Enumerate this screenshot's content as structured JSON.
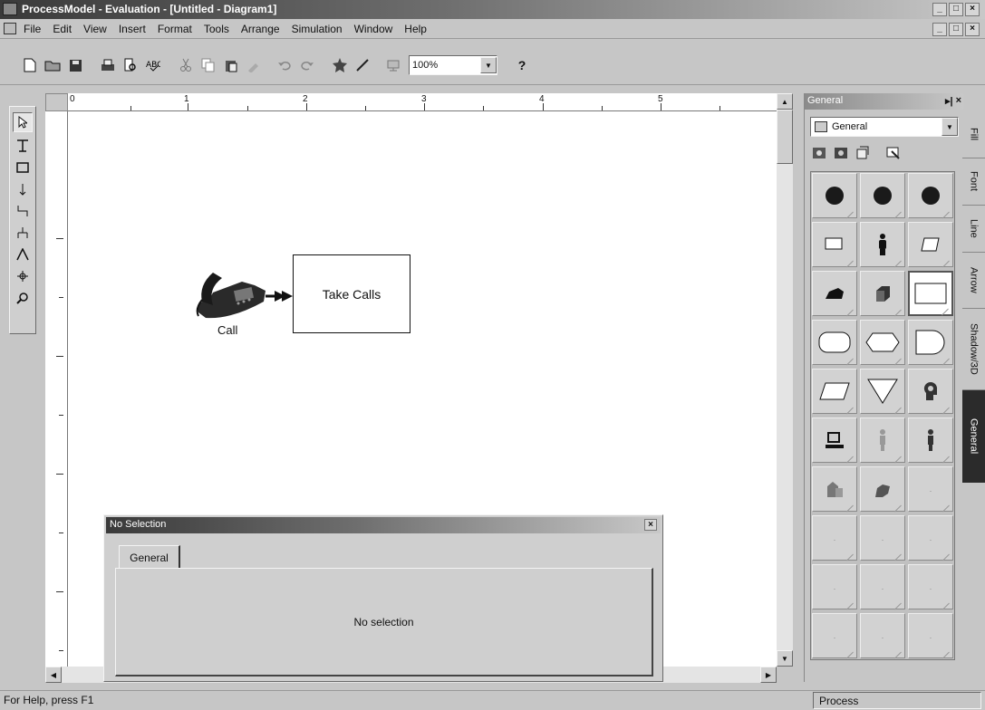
{
  "titlebar": {
    "title": "ProcessModel - Evaluation - [Untitled - Diagram1]"
  },
  "menubar": {
    "items": [
      "File",
      "Edit",
      "View",
      "Insert",
      "Format",
      "Tools",
      "Arrange",
      "Simulation",
      "Window",
      "Help"
    ]
  },
  "toolbar": {
    "zoom_value": "100%",
    "help_label": "?"
  },
  "ruler": {
    "top_labels": [
      "0",
      "1",
      "2",
      "3",
      "4",
      "5"
    ]
  },
  "canvas": {
    "call_label": "Call",
    "activity_label": "Take Calls"
  },
  "properties": {
    "title": "No Selection",
    "tab_label": "General",
    "body_text": "No selection"
  },
  "palette": {
    "title": "General",
    "dropdown_value": "General",
    "side_tabs": [
      "Fill",
      "Font",
      "Line",
      "Arrow",
      "Shadow/3D",
      "General"
    ]
  },
  "statusbar": {
    "left": "For Help, press F1",
    "right": "Process"
  }
}
